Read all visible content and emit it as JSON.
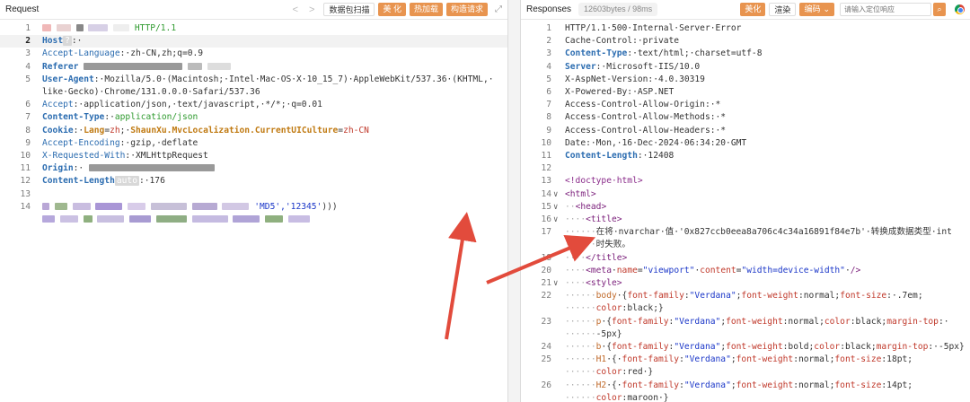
{
  "request": {
    "title": "Request",
    "nav_back": "<",
    "nav_fwd": ">",
    "buttons": [
      "数据包扫描",
      "美 化",
      "热加载",
      "构造请求"
    ],
    "expand_icon": "expand-icon",
    "lines": [
      {
        "n": "1",
        "html": "<span class=\"blur\" style=\"width:10px;background:#f0b8b8\"></span> <span class=\"blur\" style=\"width:16px;background:#e9d2d2\"></span> <span class=\"blur\" style=\"width:8px;background:#888\"></span> <span class=\"blur\" style=\"width:22px;background:#d7d0e6\"></span> <span class=\"blur\" style=\"width:18px;background:#eee\"></span> <span class=\"green\">HTTP/1.1</span>"
      },
      {
        "n": "2",
        "html": "<span class=\"k\">Host</span><span class=\"qbox\">?</span>:·"
      },
      {
        "n": "3",
        "html": "<span class=\"kv\">Accept-Language</span>:·zh-CN,zh;q=0.9"
      },
      {
        "n": "4",
        "html": "<span class=\"k\">Referer</span> <span class=\"blur\" style=\"width:110px;background:#999\"></span> <span class=\"blur\" style=\"width:16px;background:#bbb\"></span> <span class=\"blur\" style=\"width:26px;background:#ddd\"></span>"
      },
      {
        "n": "5",
        "html": "<span class=\"k\">User-Agent</span>:·Mozilla/5.0·(Macintosh;·Intel·Mac·OS·X·10_15_7)·AppleWebKit/537.36·(KHTML,·"
      },
      {
        "n": "",
        "html": "like·Gecko)·Chrome/131.0.0.0·Safari/537.36"
      },
      {
        "n": "6",
        "html": "<span class=\"kv\">Accept</span>:·application/json,·text/javascript,·*/*;·q=0.01"
      },
      {
        "n": "7",
        "html": "<span class=\"k\">Content-Type</span>:·<span class=\"green\">application/json</span>"
      },
      {
        "n": "8",
        "html": "<span class=\"k\">Cookie</span>:·<span class=\"og\">Lang</span>=<span class=\"red\">zh</span>;·<span class=\"og\">ShaunXu.MvcLocalization.CurrentUICulture</span>=<span class=\"red\">zh-CN</span>"
      },
      {
        "n": "9",
        "html": "<span class=\"kv\">Accept-Encoding</span>:·gzip,·deflate"
      },
      {
        "n": "10",
        "html": "<span class=\"kv\">X-Requested-With</span>:·XMLHttpRequest"
      },
      {
        "n": "11",
        "html": "<span class=\"k\">Origin</span>:· <span class=\"blur\" style=\"width:140px;background:#999\"></span>"
      },
      {
        "n": "12",
        "html": "<span class=\"k\">Content-Length</span><span class=\"qbox\">auto</span>:·176"
      },
      {
        "n": "13",
        "html": ""
      },
      {
        "n": "14",
        "html": "<span class=\"blur\" style=\"width:8px;background:#b9a7d6\"></span> <span class=\"blur\" style=\"width:14px;background:#9fb88f\"></span> <span class=\"blur\" style=\"width:20px;background:#c9bde0\"></span> <span class=\"blur\" style=\"width:30px;background:#a996d6\"></span> <span class=\"blur\" style=\"width:20px;background:#d8cce9\"></span> <span class=\"blur\" style=\"width:40px;background:#c7c0d8\"></span> <span class=\"blur\" style=\"width:28px;background:#b7aad3\"></span> <span class=\"blur\" style=\"width:30px;background:#d2c8e4\"></span> <span class=\"str\">'MD5','12345'</span>)))"
      },
      {
        "n": "",
        "html": "<span class=\"blur\" style=\"width:14px;background:#b6a8dc\"></span> <span class=\"blur\" style=\"width:20px;background:#cbc1e3\"></span> <span class=\"blur\" style=\"width:10px;background:#8fb07f\"></span> <span class=\"blur\" style=\"width:30px;background:#c8bfe0\"></span> <span class=\"blur\" style=\"width:24px;background:#a89bd2\"></span> <span class=\"blur\" style=\"width:34px;background:#8fae84\"></span> <span class=\"blur\" style=\"width:40px;background:#c5bbe1\"></span> <span class=\"blur\" style=\"width:30px;background:#b0a4d7\"></span> <span class=\"blur\" style=\"width:20px;background:#8fb07f\"></span> <span class=\"blur\" style=\"width:24px;background:#c8bde3\"></span>"
      }
    ]
  },
  "response": {
    "title": "Responses",
    "stats": "12603bytes / 98ms",
    "beautify_label": "美化",
    "render_label": "渲染",
    "encoding_label": "编码",
    "encoding_caret": "⌄",
    "search_placeholder": "请输入定位响应",
    "search_icon_glyph": "🔍",
    "lines": [
      {
        "n": "1",
        "fold": "",
        "html": "HTTP/1.1·500·Internal·Server·Error"
      },
      {
        "n": "2",
        "fold": "",
        "html": "Cache-Control:·private"
      },
      {
        "n": "3",
        "fold": "",
        "html": "<span class=\"k\">Content-Type</span>:·text/html;·charset=utf-8"
      },
      {
        "n": "4",
        "fold": "",
        "html": "<span class=\"k\">Server</span>:·Microsoft-IIS/10.0"
      },
      {
        "n": "5",
        "fold": "",
        "html": "X-AspNet-Version:·4.0.30319"
      },
      {
        "n": "6",
        "fold": "",
        "html": "X-Powered-By:·ASP.NET"
      },
      {
        "n": "7",
        "fold": "",
        "html": "Access-Control-Allow-Origin:·*"
      },
      {
        "n": "8",
        "fold": "",
        "html": "Access-Control-Allow-Methods:·*"
      },
      {
        "n": "9",
        "fold": "",
        "html": "Access-Control-Allow-Headers:·*"
      },
      {
        "n": "10",
        "fold": "",
        "html": "Date:·Mon,·16·Dec·2024·06:34:20·GMT"
      },
      {
        "n": "11",
        "fold": "",
        "html": "<span class=\"k\">Content-Length</span>:·12408"
      },
      {
        "n": "12",
        "fold": "",
        "html": ""
      },
      {
        "n": "13",
        "fold": "",
        "html": "<span class=\"comment\">&lt;!doctype·html&gt;</span>"
      },
      {
        "n": "14",
        "fold": "∨",
        "html": "<span class=\"tag\">&lt;html&gt;</span>"
      },
      {
        "n": "15",
        "fold": "∨",
        "html": "<span class=\"dim\">··</span><span class=\"tag\">&lt;head&gt;</span>"
      },
      {
        "n": "16",
        "fold": "∨",
        "html": "<span class=\"dim\">····</span><span class=\"tag\">&lt;title&gt;</span>"
      },
      {
        "n": "17",
        "fold": "",
        "html": "<span class=\"dim\">······</span>在将·nvarchar·值·'0x827ccb0eea8a706c4c34a16891f84e7b'·转换成数据类型·int"
      },
      {
        "n": "",
        "fold": "",
        "html": "<span class=\"dim\">······</span>时失败。"
      },
      {
        "n": "18",
        "fold": "",
        "html": "<span class=\"dim\">····</span><span class=\"tag\">&lt;/title&gt;</span>"
      },
      {
        "n": "20",
        "fold": "",
        "html": "<span class=\"dim\">····</span><span class=\"tag\">&lt;meta</span>·<span class=\"attr\">name</span>=<span class=\"str\">\"viewport\"</span>·<span class=\"attr\">content</span>=<span class=\"str\">\"width=device-width\"</span>·<span class=\"tag\">/&gt;</span>"
      },
      {
        "n": "21",
        "fold": "∨",
        "html": "<span class=\"dim\">····</span><span class=\"tag\">&lt;style&gt;</span>"
      },
      {
        "n": "22",
        "fold": "",
        "html": "<span class=\"dim\">······</span><span class=\"sel\">body</span>·{<span class=\"attr\">font-family</span>:<span class=\"str\">\"Verdana\"</span>;<span class=\"attr\">font-weight</span>:normal;<span class=\"attr\">font-size</span>:·.7em;"
      },
      {
        "n": "",
        "fold": "",
        "html": "<span class=\"dim\">······</span><span class=\"attr\">color</span>:black;}"
      },
      {
        "n": "23",
        "fold": "",
        "html": "<span class=\"dim\">······</span><span class=\"sel\">p</span>·{<span class=\"attr\">font-family</span>:<span class=\"str\">\"Verdana\"</span>;<span class=\"attr\">font-weight</span>:normal;<span class=\"attr\">color</span>:black;<span class=\"attr\">margin-top</span>:·"
      },
      {
        "n": "",
        "fold": "",
        "html": "<span class=\"dim\">······</span>-5px}"
      },
      {
        "n": "24",
        "fold": "",
        "html": "<span class=\"dim\">······</span><span class=\"sel\">b</span>·{<span class=\"attr\">font-family</span>:<span class=\"str\">\"Verdana\"</span>;<span class=\"attr\">font-weight</span>:bold;<span class=\"attr\">color</span>:black;<span class=\"attr\">margin-top</span>:·-5px}"
      },
      {
        "n": "25",
        "fold": "",
        "html": "<span class=\"dim\">······</span><span class=\"sel\">H1</span>·{·<span class=\"attr\">font-family</span>:<span class=\"str\">\"Verdana\"</span>;<span class=\"attr\">font-weight</span>:normal;<span class=\"attr\">font-size</span>:18pt;"
      },
      {
        "n": "",
        "fold": "",
        "html": "<span class=\"dim\">······</span><span class=\"attr\">color</span>:red·}"
      },
      {
        "n": "26",
        "fold": "",
        "html": "<span class=\"dim\">······</span><span class=\"sel\">H2</span>·{·<span class=\"attr\">font-family</span>:<span class=\"str\">\"Verdana\"</span>;<span class=\"attr\">font-weight</span>:normal;<span class=\"attr\">font-size</span>:14pt;"
      },
      {
        "n": "",
        "fold": "",
        "html": "<span class=\"dim\">······</span><span class=\"attr\">color</span>:maroon·}"
      }
    ]
  },
  "colors": {
    "accent": "#e8944f",
    "arrow": "#e24b3c"
  }
}
